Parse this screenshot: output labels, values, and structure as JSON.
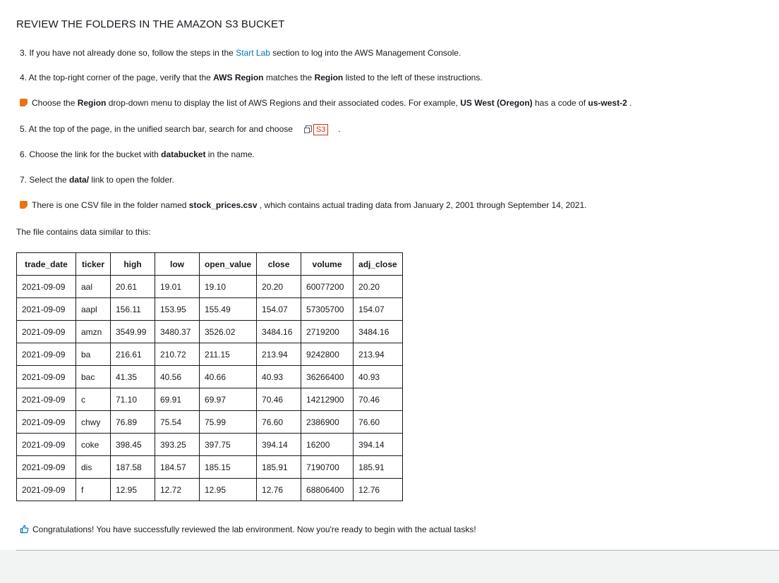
{
  "title": "REVIEW THE FOLDERS IN THE AMAZON S3 BUCKET",
  "steps": {
    "s3": {
      "pre": "3. If you have not already done so, follow the steps in the ",
      "link": "Start Lab",
      "post": " section to log into the AWS Management Console."
    },
    "s4": {
      "pre": "4. At the top-right corner of the page, verify that the ",
      "b1": "AWS Region",
      "mid": " matches the ",
      "b2": "Region",
      "post": " listed to the left of these instructions."
    },
    "note1": {
      "pre": "Choose the ",
      "b1": "Region",
      "mid1": " drop-down menu to display the list of AWS Regions and their associated codes. For example, ",
      "b2": "US West (Oregon)",
      "mid2": " has a code of ",
      "b3": "us-west-2",
      "post": " ."
    },
    "s5": {
      "pre": "5. At the top of the page, in the unified search bar, search for and choose",
      "badge": "S3",
      "post": "."
    },
    "s6": {
      "pre": "6. Choose the link for the bucket with ",
      "b1": "databucket",
      "post": " in the name."
    },
    "s7": {
      "pre": "7. Select the ",
      "b1": "data/",
      "post": " link to open the folder."
    },
    "note2": {
      "pre": "There is one CSV file in the folder named ",
      "b1": "stock_prices.csv",
      "post": " , which contains actual trading data from January 2, 2001 through September 14, 2021."
    }
  },
  "intro": "The file contains data similar to this:",
  "table": {
    "headers": [
      "trade_date",
      "ticker",
      "high",
      "low",
      "open_value",
      "close",
      "volume",
      "adj_close"
    ],
    "rows": [
      [
        "2021-09-09",
        "aal",
        "20.61",
        "19.01",
        "19.10",
        "20.20",
        "60077200",
        "20.20"
      ],
      [
        "2021-09-09",
        "aapl",
        "156.11",
        "153.95",
        "155.49",
        "154.07",
        "57305700",
        "154.07"
      ],
      [
        "2021-09-09",
        "amzn",
        "3549.99",
        "3480.37",
        "3526.02",
        "3484.16",
        "2719200",
        "3484.16"
      ],
      [
        "2021-09-09",
        "ba",
        "216.61",
        "210.72",
        "211.15",
        "213.94",
        "9242800",
        "213.94"
      ],
      [
        "2021-09-09",
        "bac",
        "41.35",
        "40.56",
        "40.66",
        "40.93",
        "36266400",
        "40.93"
      ],
      [
        "2021-09-09",
        "c",
        "71.10",
        "69.91",
        "69.97",
        "70.46",
        "14212900",
        "70.46"
      ],
      [
        "2021-09-09",
        "chwy",
        "76.89",
        "75.54",
        "75.99",
        "76.60",
        "2386900",
        "76.60"
      ],
      [
        "2021-09-09",
        "coke",
        "398.45",
        "393.25",
        "397.75",
        "394.14",
        "16200",
        "394.14"
      ],
      [
        "2021-09-09",
        "dis",
        "187.58",
        "184.57",
        "185.15",
        "185.91",
        "7190700",
        "185.91"
      ],
      [
        "2021-09-09",
        "f",
        "12.95",
        "12.72",
        "12.95",
        "12.76",
        "68806400",
        "12.76"
      ]
    ]
  },
  "congrats": "Congratulations! You have successfully reviewed the lab environment. Now you're ready to begin with the actual tasks!",
  "icons": {
    "note": "note-icon",
    "copy": "copy-icon",
    "congrats": "thumbs-up-icon"
  },
  "colors": {
    "link": "#0073bb",
    "note": "#ec7211",
    "badge": "#d13212"
  }
}
